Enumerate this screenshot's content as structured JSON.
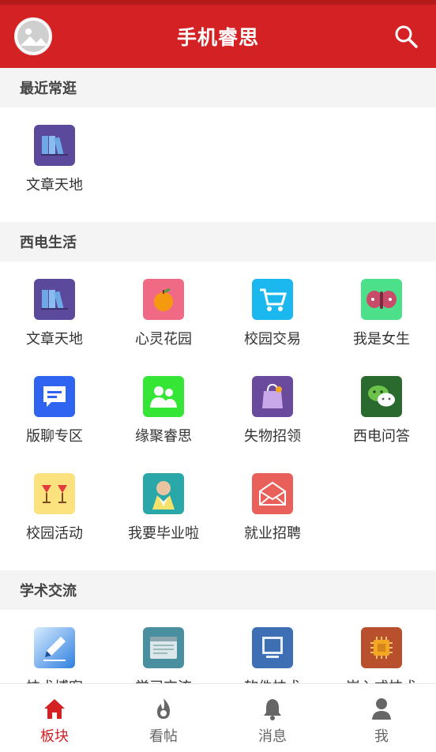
{
  "app": {
    "title": "手机睿思"
  },
  "sections": [
    {
      "title": "最近常逛",
      "items": [
        {
          "label": "文章天地",
          "icon": "books-icon"
        }
      ]
    },
    {
      "title": "西电生活",
      "items": [
        {
          "label": "文章天地",
          "icon": "books-icon"
        },
        {
          "label": "心灵花园",
          "icon": "apple-icon"
        },
        {
          "label": "校园交易",
          "icon": "cart-icon"
        },
        {
          "label": "我是女生",
          "icon": "butterfly-icon"
        },
        {
          "label": "版聊专区",
          "icon": "chat-bubble-icon"
        },
        {
          "label": "缘聚睿思",
          "icon": "people-icon"
        },
        {
          "label": "失物招领",
          "icon": "bag-icon"
        },
        {
          "label": "西电问答",
          "icon": "wechat-icon"
        },
        {
          "label": "校园活动",
          "icon": "cheers-icon"
        },
        {
          "label": "我要毕业啦",
          "icon": "graduate-icon"
        },
        {
          "label": "就业招聘",
          "icon": "envelope-icon"
        }
      ]
    },
    {
      "title": "学术交流",
      "items": [
        {
          "label": "技术博客",
          "icon": "pencil-icon"
        },
        {
          "label": "学习交流",
          "icon": "window-icon"
        },
        {
          "label": "软件技术",
          "icon": "monitor-icon"
        },
        {
          "label": "嵌入式技术",
          "icon": "chip-icon"
        }
      ]
    }
  ],
  "tabs": [
    {
      "label": "板块",
      "icon": "home-icon",
      "active": true
    },
    {
      "label": "看帖",
      "icon": "flame-icon"
    },
    {
      "label": "消息",
      "icon": "bell-icon"
    },
    {
      "label": "我",
      "icon": "person-icon"
    }
  ],
  "colors": {
    "primary": "#d42124",
    "background": "#f4f4f4"
  }
}
